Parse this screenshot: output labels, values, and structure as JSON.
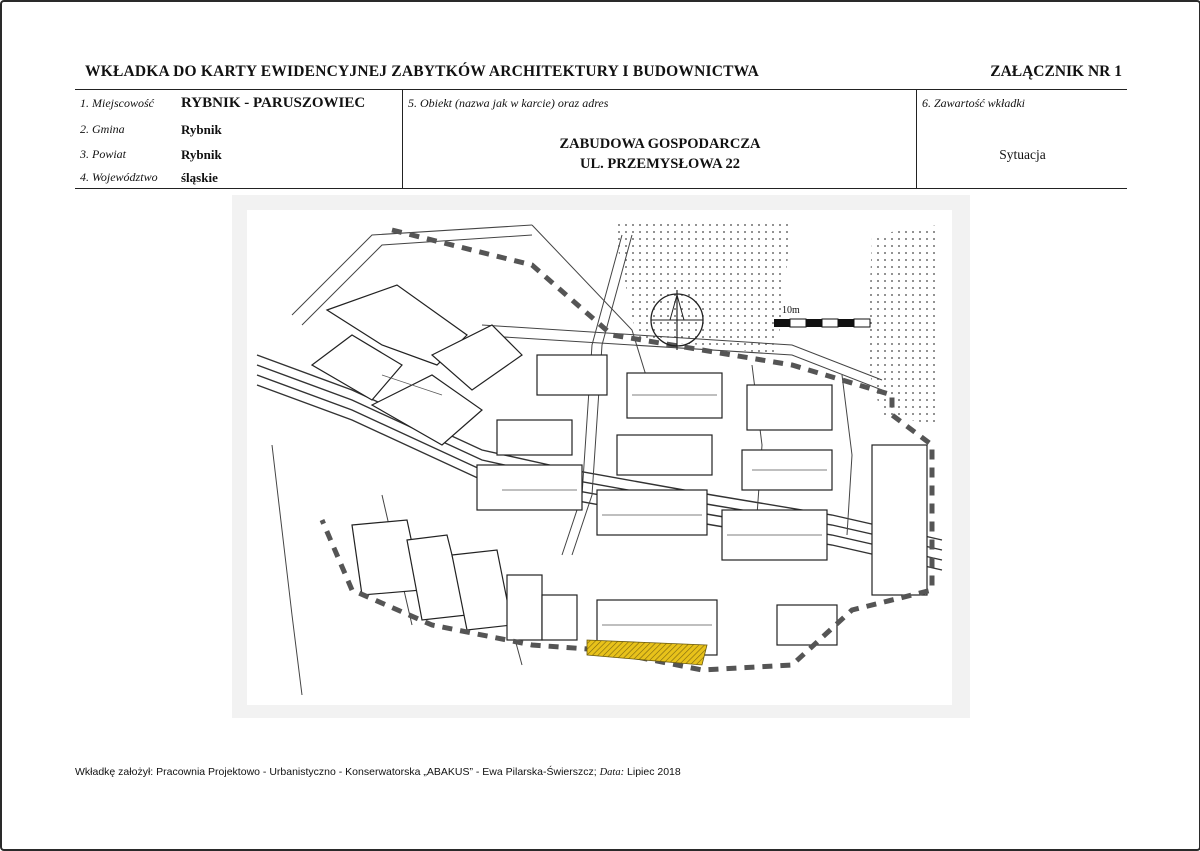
{
  "header": {
    "title": "WKŁADKA DO KARTY EWIDENCYJNEJ ZABYTKÓW ARCHITEKTURY I BUDOWNICTWA",
    "annex": "ZAŁĄCZNIK NR 1"
  },
  "fields": {
    "locality_label": "1. Miejscowość",
    "locality_value": "RYBNIK - PARUSZOWIEC",
    "commune_label": "2. Gmina",
    "commune_value": "Rybnik",
    "county_label": "3. Powiat",
    "county_value": "Rybnik",
    "voivodeship_label": "4. Województwo",
    "voivodeship_value": "śląskie",
    "object_label": "5. Obiekt (nazwa jak w karcie) oraz adres",
    "object_name": "ZABUDOWA GOSPODARCZA",
    "object_address": "UL. PRZEMYSŁOWA 22",
    "content_label": "6. Zawartość wkładki",
    "content_value": "Sytuacja"
  },
  "map": {
    "scale_label": "10m",
    "highlight_color": "#e8c21a"
  },
  "footer": {
    "prefix": "Wkładkę założył: Pracownia Projektowo - Urbanistyczno - Konserwatorska „ABAKUS” - Ewa Pilarska-Świerszcz;",
    "date_label": "Data:",
    "date_value": "Lipiec 2018"
  }
}
